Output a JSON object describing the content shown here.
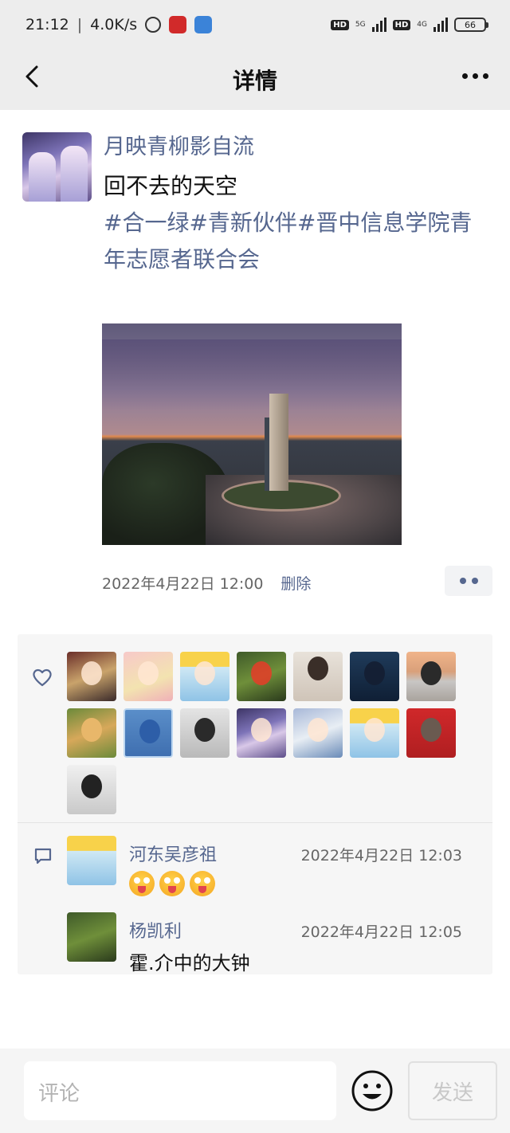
{
  "status_bar": {
    "time": "21:12",
    "speed": "4.0K/s",
    "sim1_network": "5G",
    "sim2_network": "4G",
    "hd1": "HD",
    "hd2": "HD",
    "battery": "66"
  },
  "nav": {
    "title": "详情"
  },
  "post": {
    "author": "月映青柳影自流",
    "content": "回不去的天空",
    "tags": "#合一绿#青新伙伴#晋中信息学院青年志愿者联合会",
    "time": "2022年4月22日  12:00",
    "delete_label": "删除"
  },
  "likes": {
    "count_shown": 15,
    "avatars": [
      "liker-1",
      "liker-2",
      "liker-3",
      "liker-4",
      "liker-5",
      "liker-6",
      "liker-7",
      "liker-8",
      "liker-9",
      "liker-10",
      "liker-11",
      "liker-12",
      "liker-13",
      "liker-14",
      "liker-15"
    ]
  },
  "comments": [
    {
      "name": "河东吴彦祖",
      "time": "2022年4月22日  12:03",
      "text": "",
      "emoji_count": 3
    },
    {
      "name": "杨凯利",
      "time": "2022年4月22日  12:05",
      "text": "霍.介中的大钟",
      "emoji_count": 0
    }
  ],
  "input": {
    "placeholder": "评论",
    "send_label": "发送"
  },
  "colors": {
    "link": "#56678f",
    "nav_bg": "#ededed",
    "panel_bg": "#f6f6f6"
  },
  "icons": {
    "back": "chevron-left-icon",
    "more": "more-dots-icon",
    "like": "heart-icon",
    "comment": "comment-bubble-icon",
    "emoji": "smiley-icon"
  }
}
